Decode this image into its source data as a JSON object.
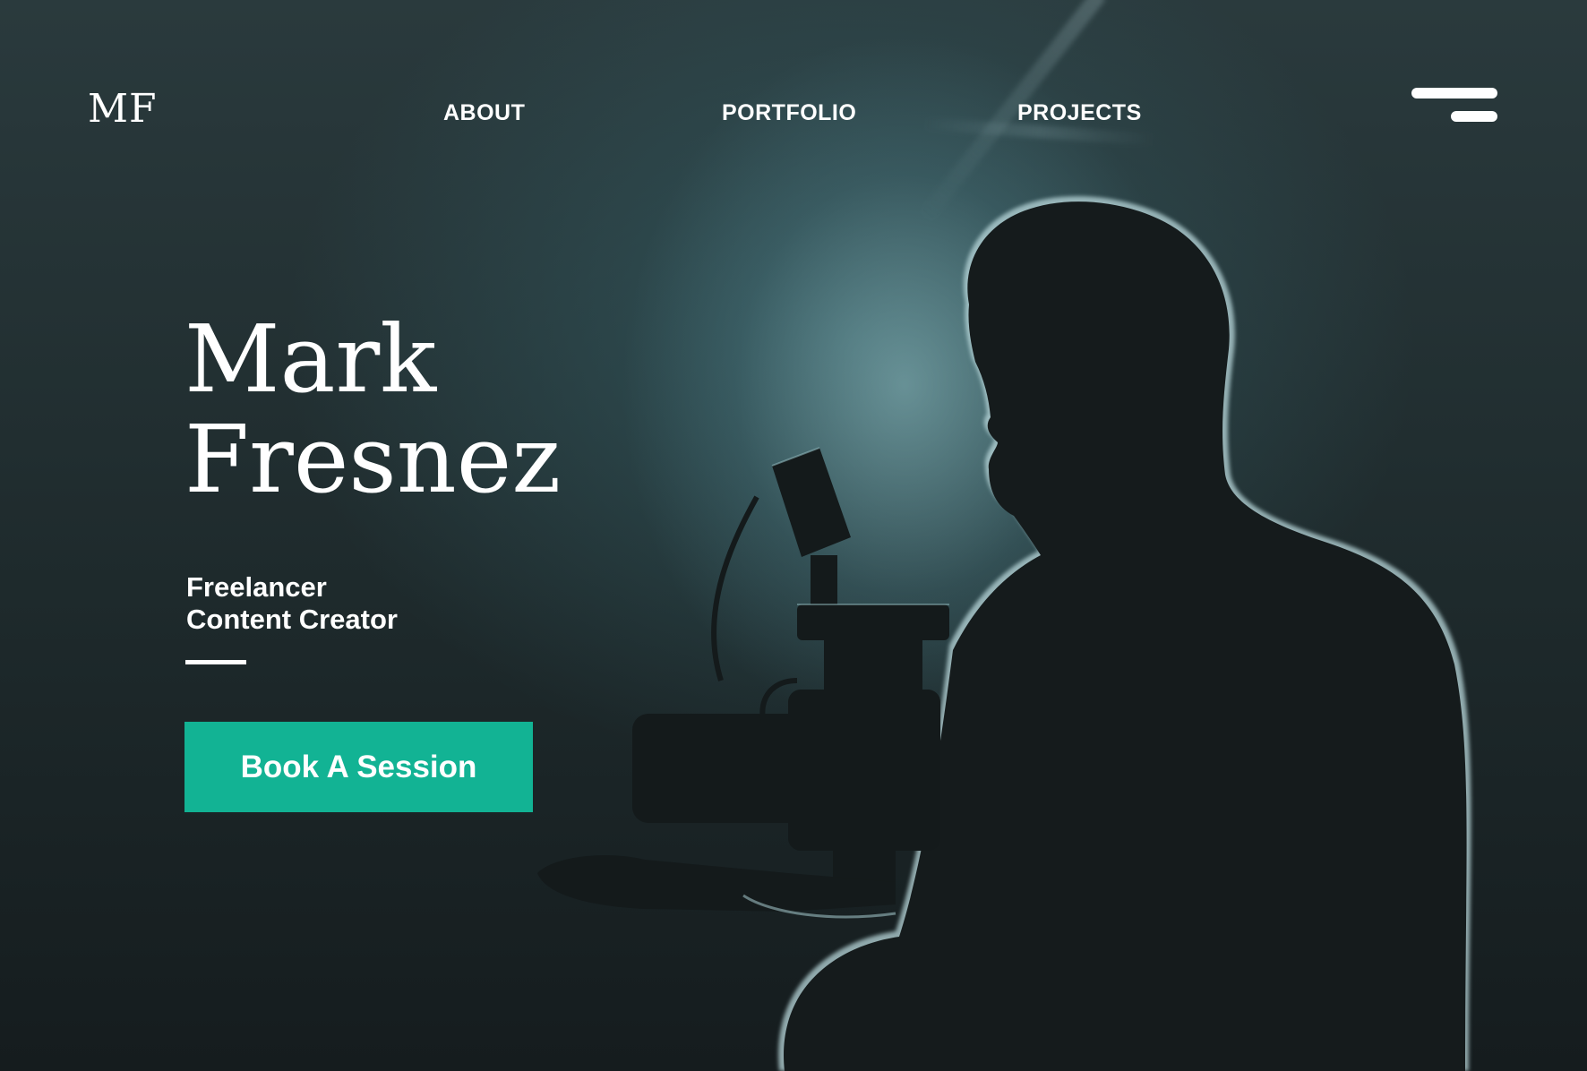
{
  "brand": {
    "logo": "MF"
  },
  "nav": {
    "items": [
      {
        "label": "ABOUT"
      },
      {
        "label": "PORTFOLIO"
      },
      {
        "label": "PROJECTS"
      }
    ],
    "menu_icon": "hamburger-menu-icon"
  },
  "hero": {
    "name_line1": "Mark",
    "name_line2": "Fresnez",
    "role_line1": "Freelancer",
    "role_line2": "Content Creator",
    "cta_label": "Book A Session",
    "cta_color": "#12b394",
    "image": "silhouette-cameraman-photo"
  }
}
